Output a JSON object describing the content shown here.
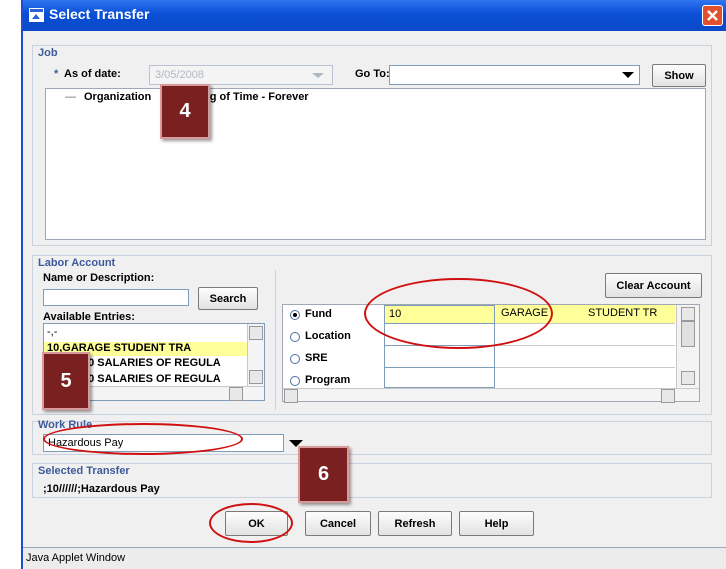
{
  "window": {
    "title": "Select Transfer",
    "status_bar": "Java Applet Window"
  },
  "job": {
    "section_title": "Job",
    "required_marker": "*",
    "as_of_label": "As of date:",
    "as_of_value": "3/05/2008",
    "goto_label": "Go To:",
    "goto_value": "",
    "show_label": "Show",
    "tree_dash": "—",
    "tree_item_a": "Organization",
    "tree_item_b": "ing of Time - Forever"
  },
  "labor_account": {
    "section_title": "Labor Account",
    "name_label": "Name or Description:",
    "search_label": "Search",
    "available_label": "Available Entries:",
    "entries": [
      "-,-",
      "10,GARAGE      STUDENT TRA",
      "50 SALARIES OF REGULA",
      "50 SALARIES OF REGULA"
    ],
    "clear_label": "Clear Account",
    "fields": [
      {
        "name": "Fund",
        "value": "10",
        "desc1": "GARAGE",
        "desc2": "STUDENT TR",
        "selected": true
      },
      {
        "name": "Location",
        "value": "",
        "desc1": "",
        "desc2": "",
        "selected": false
      },
      {
        "name": "SRE",
        "value": "",
        "desc1": "",
        "desc2": "",
        "selected": false
      },
      {
        "name": "Program",
        "value": "",
        "desc1": "",
        "desc2": "",
        "selected": false
      }
    ]
  },
  "work_rule": {
    "section_title": "Work Rule",
    "value": "Hazardous Pay"
  },
  "selected_transfer": {
    "section_title": "Selected Transfer",
    "value": ";10//////;Hazardous Pay"
  },
  "buttons": {
    "ok": "OK",
    "cancel": "Cancel",
    "refresh": "Refresh",
    "help": "Help"
  },
  "markers": {
    "m4": "4",
    "m5": "5",
    "m6": "6"
  },
  "colors": {
    "title_bar": "#0a4fd6",
    "highlight_row": "#ffff99",
    "annotation": "#d01010",
    "marker_bg": "#7a2020"
  }
}
